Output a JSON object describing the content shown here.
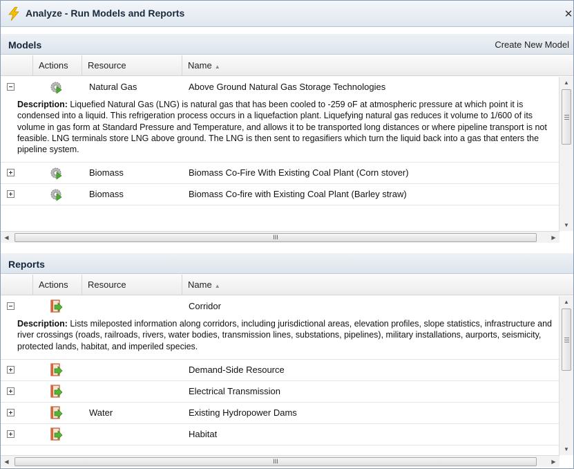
{
  "window": {
    "title": "Analyze - Run Models and Reports",
    "title_icon": "lightning-bolt-icon",
    "close_glyph": "✕"
  },
  "models": {
    "panel_title": "Models",
    "create_link": "Create New Model",
    "columns": {
      "actions": "Actions",
      "resource": "Resource",
      "name": "Name"
    },
    "rows": [
      {
        "resource": "Natural Gas",
        "name": "Above Ground Natural Gas Storage Technologies",
        "expanded": true,
        "description_label": "Description:",
        "description": " Liquefied Natural Gas (LNG) is natural gas that has been cooled to -259 oF at atmospheric pressure at which point it is condensed into a liquid. This refrigeration process occurs in a liquefaction plant. Liquefying natural gas reduces it volume to 1/600 of its volume in gas form at Standard Pressure and Temperature, and allows it to be transported long distances or where pipeline transport is not feasible. LNG terminals store LNG above ground. The LNG is then sent to regasifiers which turn the liquid back into a gas that enters the pipeline system."
      },
      {
        "resource": "Biomass",
        "name": "Biomass Co-Fire With Existing Coal Plant (Corn stover)",
        "expanded": false
      },
      {
        "resource": "Biomass",
        "name": "Biomass Co-fire with Existing Coal Plant (Barley straw)",
        "expanded": false
      }
    ],
    "action_icon": "gear-run-icon"
  },
  "reports": {
    "panel_title": "Reports",
    "columns": {
      "actions": "Actions",
      "resource": "Resource",
      "name": "Name"
    },
    "rows": [
      {
        "resource": "",
        "name": "Corridor",
        "expanded": true,
        "description_label": "Description:",
        "description": " Lists mileposted information along corridors, including jurisdictional areas, elevation profiles, slope statistics, infrastructure and river crossings (roads, railroads, rivers, water bodies, transmission lines, substations, pipelines), military installations, aurports, seismicity, protected lands, habitat, and imperiled species."
      },
      {
        "resource": "",
        "name": "Demand-Side Resource",
        "expanded": false
      },
      {
        "resource": "",
        "name": "Electrical Transmission",
        "expanded": false
      },
      {
        "resource": "Water",
        "name": "Existing Hydropower Dams",
        "expanded": false
      },
      {
        "resource": "",
        "name": "Habitat",
        "expanded": false
      }
    ],
    "action_icon": "report-export-icon"
  },
  "scrollbar": {
    "grip": "III",
    "up": "▲",
    "down": "▼",
    "left": "◀",
    "right": "▶"
  },
  "sort_indicator": "▲",
  "colors": {
    "header_bg": "#dde4ec",
    "border": "#8a9bb0",
    "accent": "#f3c300"
  }
}
